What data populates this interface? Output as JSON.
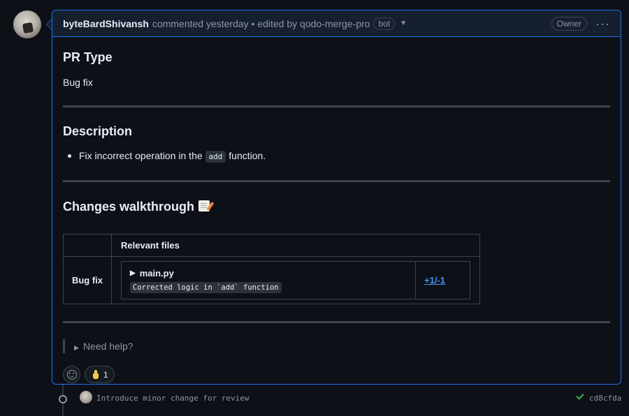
{
  "header": {
    "author": "byteBardShivansh",
    "meta": "commented yesterday • edited by qodo-merge-pro",
    "bot_badge": "bot",
    "owner_badge": "Owner"
  },
  "sections": {
    "pr_type_heading": "PR Type",
    "pr_type_value": "Bug fix",
    "description_heading": "Description",
    "description_prefix": "Fix incorrect operation in the",
    "description_code": "add",
    "description_suffix": "function.",
    "walkthrough_heading": "Changes walkthrough"
  },
  "walkthrough_table": {
    "header": "Relevant files",
    "row_label": "Bug fix",
    "file_name": "main.py",
    "file_description": "Corrected logic in `add` function",
    "diff_stat": "+1/-1"
  },
  "help": {
    "label": "Need help?"
  },
  "reactions": {
    "thumbs_up_count": "1"
  },
  "timeline": {
    "commit_message": "Introduce minor change for review",
    "commit_sha": "cd8cfda"
  },
  "colors": {
    "accent_border": "#1f6feb",
    "link": "#4493f8",
    "success": "#3fb950",
    "background": "#0d1117"
  }
}
